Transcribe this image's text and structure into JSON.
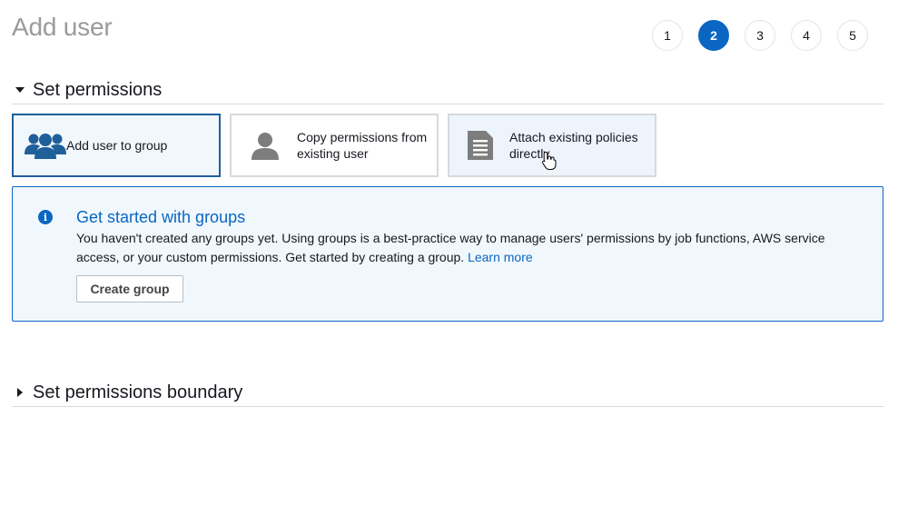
{
  "page": {
    "title": "Add user"
  },
  "steps": [
    {
      "label": "1",
      "active": false
    },
    {
      "label": "2",
      "active": true
    },
    {
      "label": "3",
      "active": false
    },
    {
      "label": "4",
      "active": false
    },
    {
      "label": "5",
      "active": false
    }
  ],
  "permissions_section": {
    "title": "Set permissions",
    "expanded": true,
    "options": [
      {
        "label": "Add user to group",
        "icon": "group-icon",
        "selected": true
      },
      {
        "label": "Copy permissions from existing user",
        "icon": "user-icon",
        "selected": false
      },
      {
        "label": "Attach existing policies directly",
        "icon": "document-icon",
        "selected": false
      }
    ]
  },
  "info_box": {
    "icon": "info-icon",
    "title": "Get started with groups",
    "text": "You haven't created any groups yet. Using groups is a best-practice way to manage users' permissions by job functions, AWS service access, or your custom permissions. Get started by creating a group.",
    "link_text": "Learn more",
    "button_label": "Create group"
  },
  "boundary_section": {
    "title": "Set permissions boundary",
    "expanded": false
  },
  "colors": {
    "accent": "#0a66c2",
    "selected_border": "#1f5f9a",
    "info_background": "#f1f8fd",
    "title_gray": "#9a9a9a"
  }
}
